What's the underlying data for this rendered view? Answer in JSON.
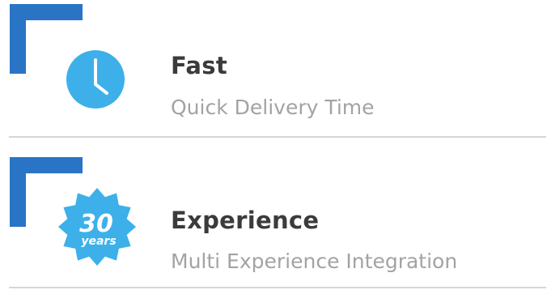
{
  "features": [
    {
      "title": "Fast",
      "subtitle": "Quick Delivery Time",
      "icon": "clock-icon"
    },
    {
      "title": "Experience",
      "subtitle": "Multi Experience Integration",
      "icon": "years-badge-icon",
      "badge": {
        "number": "30",
        "label": "years"
      }
    }
  ],
  "colors": {
    "accent": "#2a74c6",
    "icon": "#3db0ea",
    "title": "#3b3b3b",
    "subtitle": "#a3a3a3",
    "divider": "#d6d6d6"
  }
}
